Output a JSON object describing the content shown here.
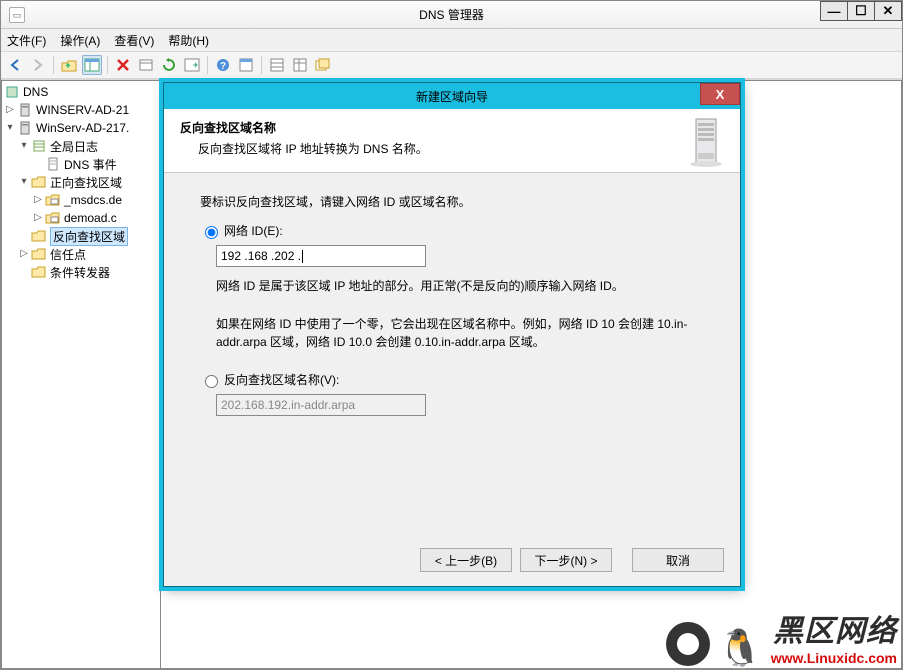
{
  "window": {
    "title": "DNS 管理器",
    "controls": {
      "min": "—",
      "max": "☐",
      "close": "✕"
    }
  },
  "menu": {
    "file": "文件(F)",
    "action": "操作(A)",
    "view": "查看(V)",
    "help": "帮助(H)"
  },
  "toolbar_icons": {
    "back": "back-arrow-icon",
    "fwd": "forward-arrow-icon",
    "up": "up-folder-icon",
    "home": "panes-icon",
    "delete": "delete-icon",
    "refresh1": "refresh-icon",
    "refresh2": "refresh-green-icon",
    "export-list": "export-list-icon",
    "help": "help-icon",
    "props": "properties-icon",
    "list1": "list-pane-icon",
    "list2": "detail-pane-icon",
    "list3": "new-window-icon"
  },
  "tree": {
    "root": "DNS",
    "servers": [
      {
        "name": "WINSERV-AD-21",
        "expanded": false
      },
      {
        "name": "WinServ-AD-217.",
        "expanded": true,
        "children": [
          {
            "label": "全局日志",
            "type": "folder-book",
            "children": [
              {
                "label": "DNS 事件",
                "type": "doc"
              }
            ]
          },
          {
            "label": "正向查找区域",
            "type": "folder",
            "children": [
              {
                "label": "_msdcs.de",
                "type": "zone"
              },
              {
                "label": "demoad.c",
                "type": "zone"
              }
            ]
          },
          {
            "label": "反向查找区域",
            "type": "folder",
            "selected": true
          },
          {
            "label": "信任点",
            "type": "folder"
          },
          {
            "label": "条件转发器",
            "type": "folder"
          }
        ]
      }
    ]
  },
  "dialog": {
    "title": "新建区域向导",
    "header_title": "反向查找区域名称",
    "header_sub": "反向查找区域将 IP 地址转换为 DNS 名称。",
    "intro": "要标识反向查找区域，请键入网络 ID 或区域名称。",
    "option1_label": "网络 ID(E):",
    "network_id_value": "192 .168 .202 .",
    "option1_desc": "网络 ID 是属于该区域 IP 地址的部分。用正常(不是反向的)顺序输入网络 ID。",
    "option1_note": "如果在网络 ID 中使用了一个零，它会出现在区域名称中。例如，网络 ID 10 会创建 10.in-addr.arpa 区域，网络 ID 10.0 会创建 0.10.in-addr.arpa 区域。",
    "option2_label": "反向查找区域名称(V):",
    "zone_name_value": "202.168.192.in-addr.arpa",
    "buttons": {
      "back": "< 上一步(B)",
      "next": "下一步(N) >",
      "cancel": "取消"
    }
  },
  "watermark": {
    "brand": "黑区网络",
    "url": "www.Linuxidc.com"
  }
}
